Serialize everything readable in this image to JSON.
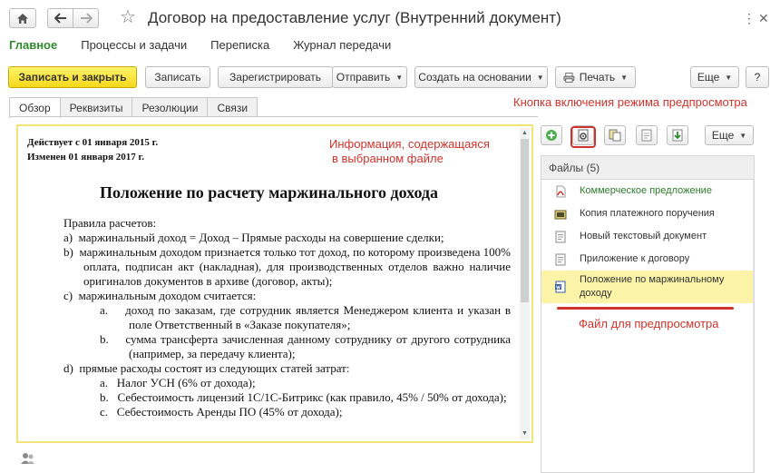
{
  "window": {
    "title": "Договор на предоставление услуг (Внутренний документ)",
    "controls": [
      "⋮",
      "✕"
    ]
  },
  "sections": [
    "Главное",
    "Процессы и задачи",
    "Переписка",
    "Журнал передачи"
  ],
  "toolbar": {
    "save_close": "Записать и закрыть",
    "save": "Записать",
    "register": "Зарегистрировать",
    "send": "Отправить",
    "create_based": "Создать на основании",
    "print": "Печать",
    "more": "Еще",
    "help": "?"
  },
  "tabs": [
    "Обзор",
    "Реквизиты",
    "Резолюции",
    "Связи"
  ],
  "annotations": {
    "preview_button": "Кнопка включения режима предпросмотра",
    "file_info_1": "Информация, содержащаяся",
    "file_info_2": "в выбранном файле",
    "preview_file": "Файл для предпросмотра"
  },
  "document": {
    "effective": "Действует с 01 января 2015 г.",
    "changed": "Изменен 01 января 2017 г.",
    "heading": "Положение по расчету маржинального дохода",
    "intro": "Правила расчетов:",
    "items": [
      {
        "marker": "a)",
        "text": "маржинальный доход = Доход – Прямые расходы на совершение сделки;"
      },
      {
        "marker": "b)",
        "text": "маржинальным доходом признается только тот доход, по которому произведена 100% оплата, подписан акт (накладная), для производственных отделов важно наличие оригиналов документов в архиве (договор, акты);"
      },
      {
        "marker": "c)",
        "text": "маржинальным доходом считается:"
      },
      {
        "marker": "a.",
        "text": "доход по заказам, где сотрудник является Менеджером клиента и указан в поле Ответственный в «Заказе покупателя»;"
      },
      {
        "marker": "b.",
        "text": "сумма трансферта зачисленная данному сотруднику от другого сотрудника (например, за передачу клиента);"
      },
      {
        "marker": "d)",
        "text": "прямые расходы состоят из следующих статей затрат:"
      },
      {
        "marker": "a.",
        "text": "Налог УСН (6% от дохода);"
      },
      {
        "marker": "b.",
        "text": "Себестоимость лицензий 1С/1С-Битрикс (как правило, 45% / 50% от дохода);"
      },
      {
        "marker": "c.",
        "text": "Себестоимость Аренды ПО (45% от дохода);"
      }
    ]
  },
  "files": {
    "more": "Еще",
    "header": "Файлы (5)",
    "items": [
      {
        "name": "Коммерческое предложение",
        "icon": "pdf-icon",
        "color": "#2e7d2e"
      },
      {
        "name": "Копия платежного поручения",
        "icon": "image-file-icon",
        "color": "#333333"
      },
      {
        "name": "Новый текстовый документ",
        "icon": "text-file-icon",
        "color": "#333333"
      },
      {
        "name": "Приложение к договору",
        "icon": "text-file-icon",
        "color": "#333333"
      },
      {
        "name": "Положение по маржинальному доходу",
        "icon": "word-file-icon",
        "color": "#333333"
      }
    ]
  },
  "colors": {
    "accent_green": "#2e8b2e",
    "annotation_red": "#d0332b",
    "primary_button": "#f6d81a",
    "selected_row": "#faf3a8"
  }
}
